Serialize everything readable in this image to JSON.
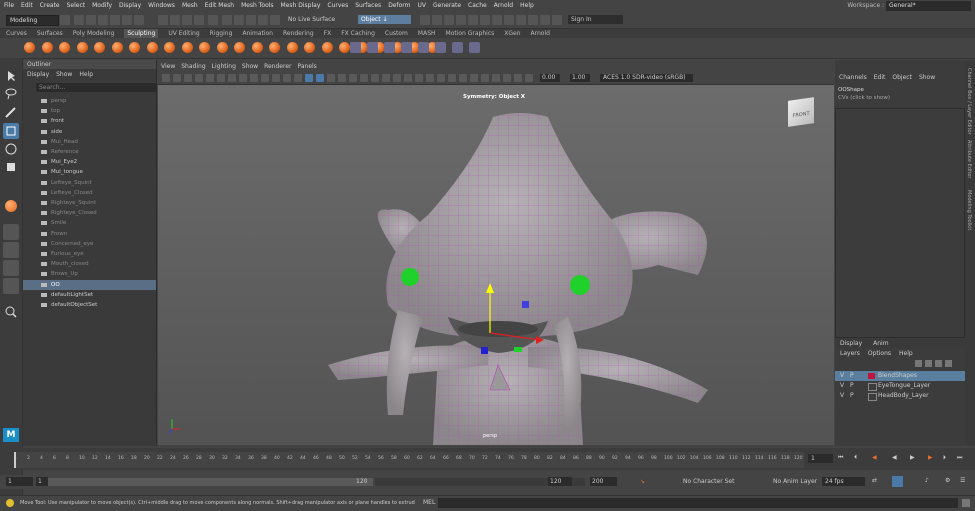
{
  "menubar": {
    "items": [
      "File",
      "Edit",
      "Create",
      "Select",
      "Modify",
      "Display",
      "Windows",
      "Mesh",
      "Edit Mesh",
      "Mesh Tools",
      "Mesh Display",
      "Curves",
      "Surfaces",
      "Deform",
      "UV",
      "Generate",
      "Cache",
      "Arnold",
      "Help"
    ],
    "workspace_label": "Workspace :",
    "workspace_value": "General*"
  },
  "statusline": {
    "mode": "Modeling",
    "live_surface": "No Live Surface",
    "object_field": "Object ↓",
    "sign_in": "Sign In"
  },
  "shelf": {
    "tabs": [
      "Curves",
      "Surfaces",
      "Poly Modeling",
      "Sculpting",
      "UV Editing",
      "Rigging",
      "Animation",
      "Rendering",
      "FX",
      "FX Caching",
      "Custom",
      "MASH",
      "Motion Graphics",
      "XGen",
      "Arnold"
    ],
    "active_tab": "Sculpting"
  },
  "outliner": {
    "title": "Outliner",
    "menu": [
      "Display",
      "Show",
      "Help"
    ],
    "search_placeholder": "Search...",
    "items": [
      {
        "label": "persp",
        "dim": true
      },
      {
        "label": "top",
        "dim": true
      },
      {
        "label": "front",
        "dim": false
      },
      {
        "label": "side",
        "dim": false
      },
      {
        "label": "Mui_Head",
        "dim": true
      },
      {
        "label": "Reference",
        "dim": true
      },
      {
        "label": "Mui_Eye2",
        "dim": false
      },
      {
        "label": "Mui_tongue",
        "dim": false
      },
      {
        "label": "Lefteye_Squint",
        "dim": true
      },
      {
        "label": "Lefteye_Closed",
        "dim": true
      },
      {
        "label": "Righteye_Squint",
        "dim": true
      },
      {
        "label": "Righteye_Closed",
        "dim": true
      },
      {
        "label": "Smile",
        "dim": true
      },
      {
        "label": "Frown",
        "dim": true
      },
      {
        "label": "Concerned_eye",
        "dim": true
      },
      {
        "label": "Furious_eye",
        "dim": true
      },
      {
        "label": "Mouth_closed",
        "dim": true
      },
      {
        "label": "Brows_Up",
        "dim": true
      },
      {
        "label": "OO",
        "dim": false,
        "selected": true
      },
      {
        "label": "defaultLightSet",
        "dim": false
      },
      {
        "label": "defaultObjectSet",
        "dim": false
      }
    ]
  },
  "viewport": {
    "menu": [
      "View",
      "Shading",
      "Lighting",
      "Show",
      "Renderer",
      "Panels"
    ],
    "symmetry": "Symmetry: Object X",
    "camera_label": "persp",
    "viewcube": "FRONT",
    "field1": "0.00",
    "field2": "1.00",
    "colorspace": "ACES 1.0 SDR-video (sRGB)"
  },
  "channelbox": {
    "menu": [
      "Channels",
      "Edit",
      "Object",
      "Show"
    ],
    "shape": "OOShape",
    "cvs": "CVs (click to show)"
  },
  "layers": {
    "tabs": [
      "Display",
      "Anim"
    ],
    "menu": [
      "Layers",
      "Options",
      "Help"
    ],
    "rows": [
      {
        "v": "V",
        "p": "P",
        "r": "",
        "name": "BlendShapes",
        "color": "#c0143c",
        "selected": true
      },
      {
        "v": "V",
        "p": "P",
        "r": "",
        "name": "EyeTongue_Layer",
        "color": "",
        "selected": false
      },
      {
        "v": "V",
        "p": "P",
        "r": "",
        "name": "HeadBody_Layer",
        "color": "",
        "selected": false
      }
    ]
  },
  "sidetabs": [
    "Channel Box / Layer Editor",
    "Attribute Editor",
    "Modeling Toolkit"
  ],
  "timeslider": {
    "ticks": [
      "1",
      "2",
      "4",
      "6",
      "8",
      "10",
      "12",
      "14",
      "16",
      "18",
      "20",
      "22",
      "24",
      "26",
      "28",
      "30",
      "32",
      "34",
      "36",
      "38",
      "40",
      "42",
      "44",
      "46",
      "48",
      "50",
      "52",
      "54",
      "56",
      "58",
      "60",
      "62",
      "64",
      "66",
      "68",
      "70",
      "72",
      "74",
      "76",
      "78",
      "80",
      "82",
      "84",
      "86",
      "88",
      "90",
      "92",
      "94",
      "96",
      "98",
      "100",
      "102",
      "104",
      "106",
      "108",
      "110",
      "112",
      "114",
      "116",
      "118",
      "120"
    ],
    "current": "1"
  },
  "range": {
    "start": "1",
    "start2": "1",
    "end": "120",
    "end2": "120",
    "max": "200",
    "character": "No Character Set",
    "anim_layer": "No Anim Layer",
    "fps": "24 fps"
  },
  "helpline": {
    "text": "Move Tool: Use manipulator to move object(s). Ctrl+middle drag to move components along normals. Shift+drag manipulator axis or plane handles to extrude components or cli",
    "mel": "MEL"
  },
  "colors": {
    "accent": "#5d7e9e",
    "selection": "#5a6e85",
    "bg": "#444444"
  }
}
